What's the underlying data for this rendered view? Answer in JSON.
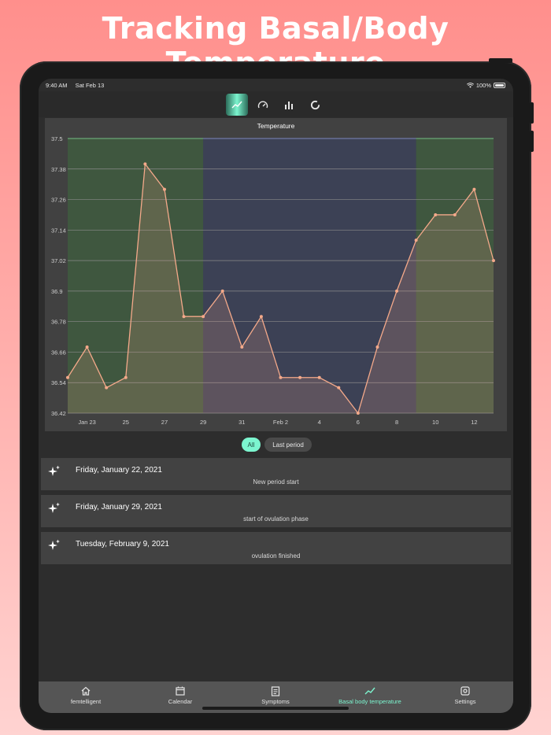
{
  "banner": {
    "title": "Tracking Basal/Body Temperature"
  },
  "status": {
    "time": "9:40 AM",
    "date": "Sat Feb 13",
    "battery": "100%"
  },
  "top_tabs": [
    {
      "icon": "trend-line-icon",
      "active": true
    },
    {
      "icon": "speedometer-icon",
      "active": false
    },
    {
      "icon": "bar-chart-icon",
      "active": false
    },
    {
      "icon": "ring-chart-icon",
      "active": false
    }
  ],
  "chart_data": {
    "type": "line",
    "title": "Temperature",
    "xlabel": "",
    "ylabel": "",
    "x": [
      "Jan 22",
      "Jan 23",
      "Jan 24",
      "Jan 25",
      "Jan 26",
      "Jan 27",
      "Jan 28",
      "Jan 29",
      "Jan 30",
      "Jan 31",
      "Feb 1",
      "Feb 2",
      "Feb 3",
      "Feb 4",
      "Feb 5",
      "Feb 6",
      "Feb 7",
      "Feb 8",
      "Feb 9",
      "Feb 10",
      "Feb 11",
      "Feb 12",
      "Feb 13"
    ],
    "series": [
      {
        "values": [
          36.56,
          36.68,
          36.52,
          36.56,
          37.4,
          37.3,
          36.8,
          36.8,
          36.9,
          36.68,
          36.8,
          36.56,
          36.56,
          36.56,
          36.52,
          36.42,
          36.68,
          36.9,
          37.1,
          37.2,
          37.2,
          37.3,
          37.02
        ]
      }
    ],
    "x_tick_labels": [
      "Jan 23",
      "25",
      "27",
      "29",
      "31",
      "Feb 2",
      "4",
      "6",
      "8",
      "10",
      "12"
    ],
    "y_tick_labels": [
      "37.5",
      "37.38",
      "37.26",
      "37.14",
      "37.02",
      "36.9",
      "36.78",
      "36.66",
      "36.54",
      "36.42"
    ],
    "ylim": [
      36.42,
      37.5
    ],
    "phases": [
      {
        "from": "Jan 22",
        "to": "Jan 29",
        "color": "#3f5a3f"
      },
      {
        "from": "Jan 29",
        "to": "Feb 9",
        "color": "#3c4158"
      },
      {
        "from": "Feb 9",
        "to": "Feb 13",
        "color": "#3f5a3f"
      }
    ],
    "line_color": "#f4a98a",
    "grid": true,
    "legend": "none"
  },
  "filters": {
    "all": "All",
    "last_period": "Last period"
  },
  "events": [
    {
      "date": "Friday, January 22, 2021",
      "note": "New period start"
    },
    {
      "date": "Friday, January 29, 2021",
      "note": "start of ovulation phase"
    },
    {
      "date": "Tuesday, February 9, 2021",
      "note": "ovulation finished"
    }
  ],
  "nav": [
    {
      "label": "femtelligent",
      "icon": "home-icon",
      "active": false
    },
    {
      "label": "Calendar",
      "icon": "calendar-icon",
      "active": false
    },
    {
      "label": "Symptoms",
      "icon": "clipboard-icon",
      "active": false
    },
    {
      "label": "Basal body temperature",
      "icon": "trend-line-icon",
      "active": true
    },
    {
      "label": "Settings",
      "icon": "gear-icon",
      "active": false
    }
  ],
  "colors": {
    "accent": "#7cf5cf",
    "chart_line": "#f4a98a",
    "background": "#2d2d2d"
  }
}
